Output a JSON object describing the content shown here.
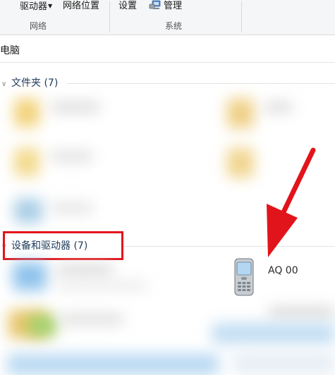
{
  "ribbon": {
    "drive_label": "驱动器",
    "network_location_label": "网络位置",
    "settings_label": "设置",
    "manage_label": "管理",
    "network_group_label": "网络",
    "system_group_label": "系统"
  },
  "address": {
    "path": "电脑"
  },
  "sections": {
    "folders_header": "文件夹 (7)",
    "devices_header": "设备和驱动器 (7)"
  },
  "devices": {
    "phone_label": "AQ     00"
  },
  "colors": {
    "highlight": "#e2141b",
    "arrow": "#e2141b",
    "header_text": "#1e395b"
  }
}
